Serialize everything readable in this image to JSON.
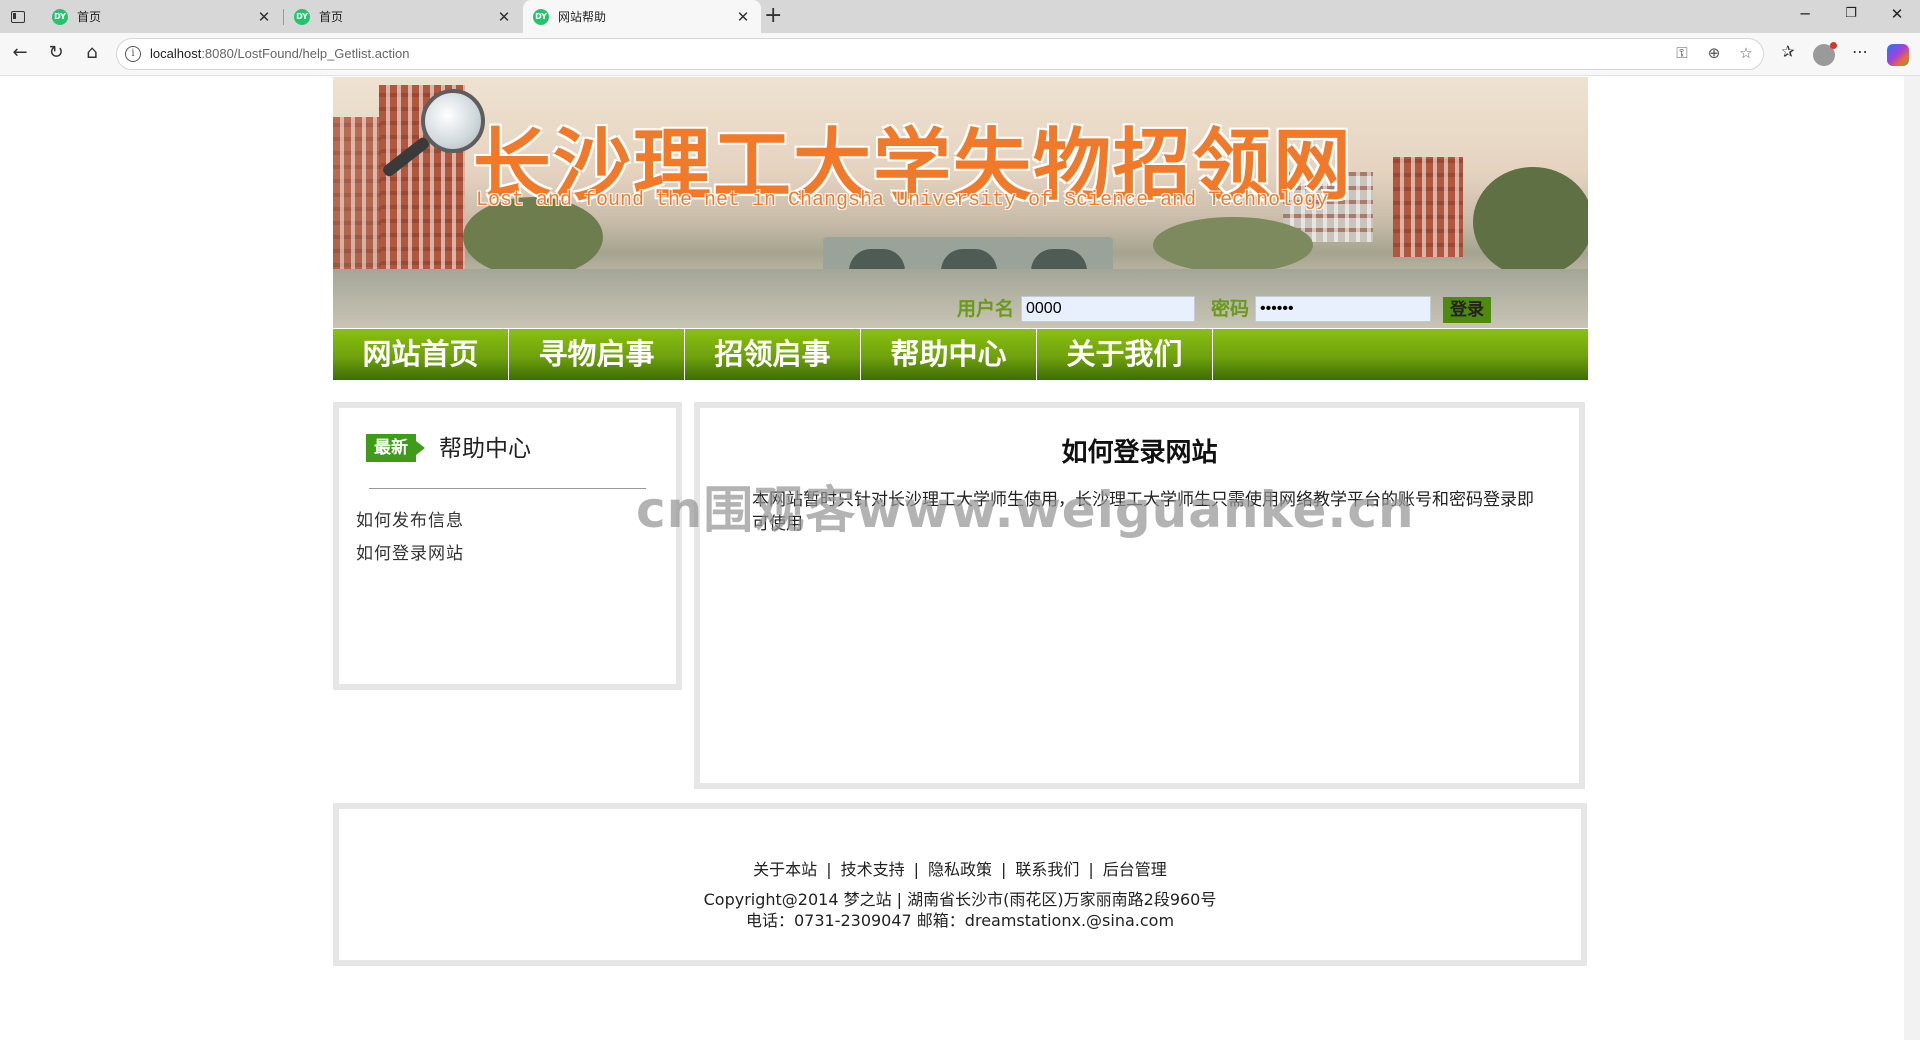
{
  "browser": {
    "tabs": [
      {
        "title": "首页",
        "favicon": "DY"
      },
      {
        "title": "首页",
        "favicon": "DY"
      },
      {
        "title": "网站帮助",
        "favicon": "DY",
        "active": true
      }
    ],
    "address": {
      "host": "localhost",
      "rest": ":8080/LostFound/help_Getlist.action"
    }
  },
  "banner": {
    "title": "长沙理工大学失物招领网",
    "subtitle": "Lost and found the net in Changsha University of Science and Technology"
  },
  "login": {
    "username_label": "用户名",
    "username_value": "0000",
    "password_label": "密码",
    "password_value": "••••••",
    "submit_label": "登录"
  },
  "nav": [
    "网站首页",
    "寻物启事",
    "招领启事",
    "帮助中心",
    "关于我们"
  ],
  "sidebar": {
    "badge": "最新",
    "title": "帮助中心",
    "links": [
      "如何发布信息",
      "如何登录网站"
    ]
  },
  "article": {
    "title": "如何登录网站",
    "body": "本网站暂时只针对长沙理工大学师生使用，长沙理工大学师生只需使用网络教学平台的账号和密码登录即可使用"
  },
  "watermark": "cn围观客www.weiguanke.cn",
  "footer": {
    "links": [
      "关于本站",
      "技术支持",
      "隐私政策",
      "联系我们",
      "后台管理"
    ],
    "separator": "|",
    "copyright": "Copyright@2014 梦之站 | 湖南省长沙市(雨花区)万家丽南路2段960号",
    "contact": "电话：0731-2309047 邮箱：dreamstationx.@sina.com"
  },
  "colors": {
    "nav_green": "#6fa10d",
    "title_orange": "#f07a2a",
    "login_label_green": "#6a9a1a",
    "badge_green": "#3f9b1a"
  }
}
